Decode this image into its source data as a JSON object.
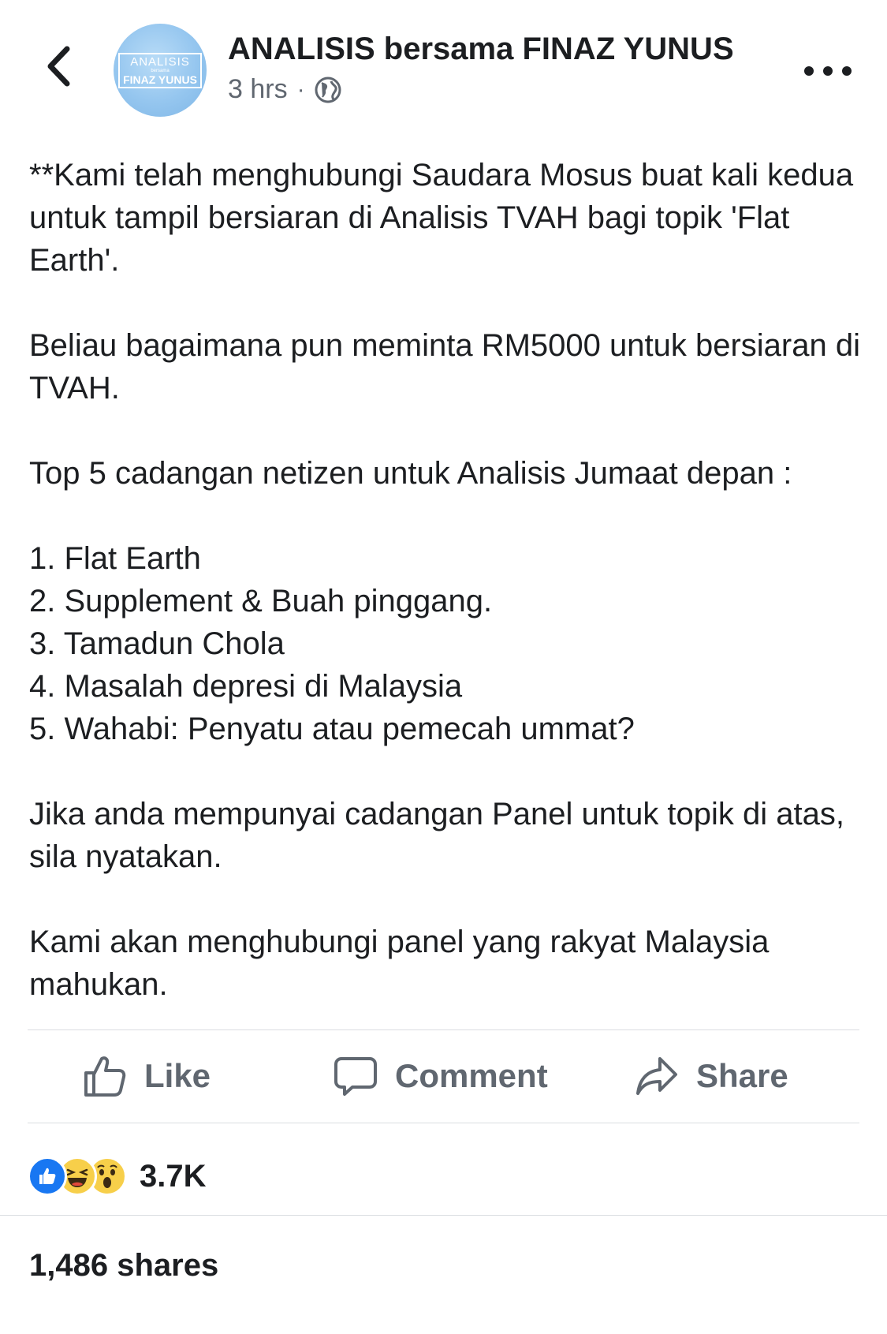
{
  "header": {
    "page_name": "ANALISIS bersama FINAZ YUNUS",
    "time": "3 hrs",
    "separator": "·",
    "privacy_icon": "globe-icon",
    "back_icon": "chevron-left-icon",
    "more_icon": "more-options-icon",
    "avatar": {
      "line1": "ANALISIS",
      "line2": "bersama",
      "line3": "FINAZ YUNUS"
    }
  },
  "post": {
    "para1": "**Kami telah menghubungi Saudara Mosus buat kali kedua untuk tampil bersiaran di Analisis TVAH bagi topik 'Flat Earth'.",
    "para2": "Beliau bagaimana pun meminta RM5000 untuk bersiaran di TVAH.",
    "para3": "Top 5 cadangan netizen untuk Analisis Jumaat depan :",
    "list": [
      "1. Flat Earth",
      "2. Supplement & Buah pinggang.",
      "3. Tamadun Chola",
      "4. Masalah depresi di Malaysia",
      "5. Wahabi: Penyatu atau pemecah ummat?"
    ],
    "para4": "Jika anda mempunyai cadangan Panel untuk topik di atas, sila nyatakan.",
    "para5": "Kami akan menghubungi panel yang rakyat Malaysia mahukan."
  },
  "actions": {
    "like": "Like",
    "comment": "Comment",
    "share": "Share"
  },
  "reactions": {
    "icons": [
      "like-reaction-icon",
      "haha-reaction-icon",
      "wow-reaction-icon"
    ],
    "count": "3.7K"
  },
  "shares": "1,486 shares",
  "colors": {
    "text": "#1c1e21",
    "secondary": "#606770",
    "divider": "#dadde1",
    "like_blue": "#1877f2",
    "emoji_yellow": "#f7cf4a",
    "avatar_blue": "#95c6ef"
  }
}
